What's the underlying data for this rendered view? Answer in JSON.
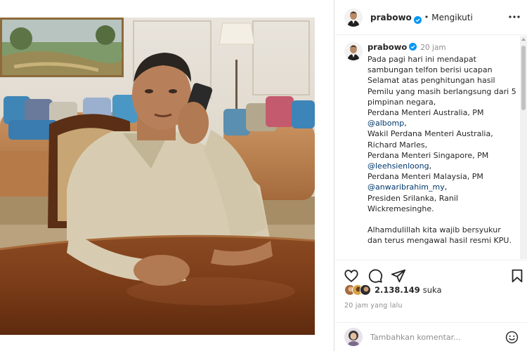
{
  "post": {
    "username": "prabowo",
    "follow_status": "Mengikuti",
    "dot": "•",
    "time_ago": "20 jam"
  },
  "caption": {
    "line1": "Pada pagi hari ini mendapat sambungan telfon berisi ucapan Selamat atas penghitungan hasil Pemilu yang masih berlangsung dari 5 pimpinan negara,",
    "line2": "Perdana Menteri Australia, PM",
    "mention1": "@albomp",
    "line3": "Wakil Perdana Menteri Australia, Richard Marles,",
    "line4": "Perdana Menteri Singapore, PM",
    "mention2": "@leehsienloong",
    "line5": "Perdana Menteri Malaysia, PM",
    "mention3": "@anwaribrahim_my",
    "line6": "Presiden Srilanka, Ranil Wickremesinghe.",
    "line7": "Alhamdulillah kita wajib bersyukur dan terus mengawal hasil resmi KPU."
  },
  "engagement": {
    "likes_count": "2.138.149",
    "likes_word": "suka",
    "posted": "20 jam yang lalu"
  },
  "comment_box": {
    "placeholder": "Tambahkan komentar..."
  },
  "colors": {
    "link": "#00376b",
    "verified": "#0095f6",
    "muted": "#8e8e8e"
  },
  "icons": [
    "more-icon",
    "verified-icon",
    "heart-icon",
    "comment-icon",
    "share-icon",
    "bookmark-icon",
    "emoji-icon"
  ]
}
